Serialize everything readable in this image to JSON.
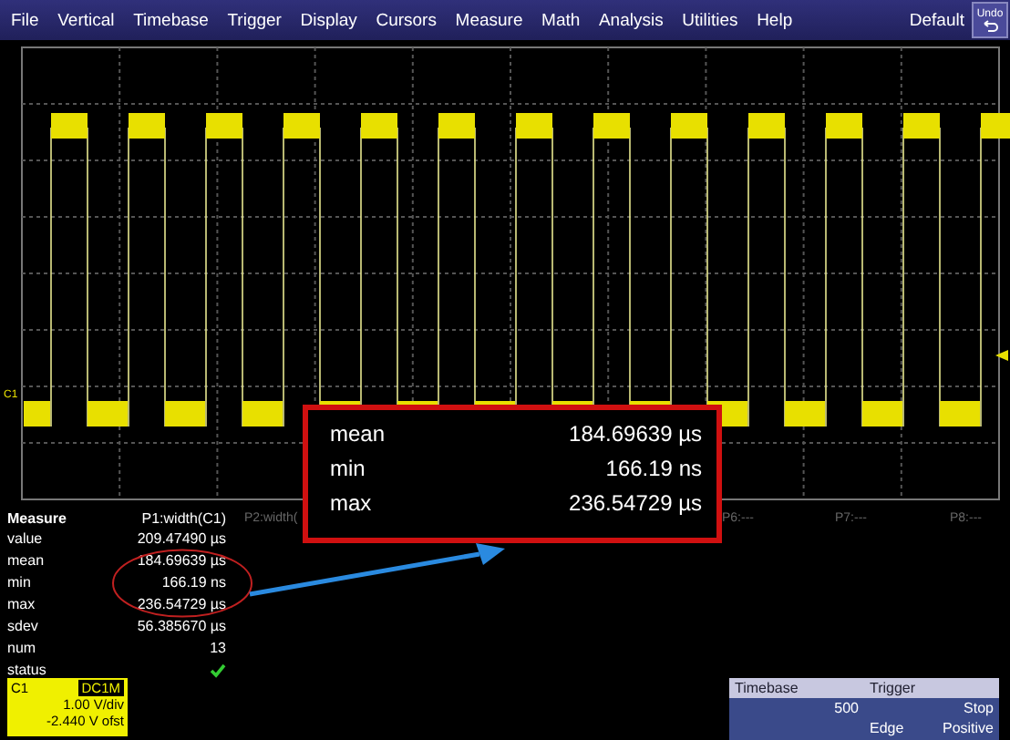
{
  "menu": {
    "items": [
      "File",
      "Vertical",
      "Timebase",
      "Trigger",
      "Display",
      "Cursors",
      "Measure",
      "Math",
      "Analysis",
      "Utilities",
      "Help"
    ],
    "preset": "Default",
    "undo": "Undo"
  },
  "scope": {
    "channel_marker": "C1"
  },
  "callout": {
    "rows": [
      {
        "label": "mean",
        "value": "184.69639 µs"
      },
      {
        "label": "min",
        "value": "166.19 ns"
      },
      {
        "label": "max",
        "value": "236.54729 µs"
      }
    ]
  },
  "measure": {
    "title": "Measure",
    "params": [
      {
        "label": "P1:width(C1)",
        "active": true
      },
      {
        "label": "P2:width(",
        "active": false
      },
      {
        "label": "P6:---",
        "active": false
      },
      {
        "label": "P7:---",
        "active": false
      },
      {
        "label": "P8:---",
        "active": false
      }
    ],
    "rows": [
      {
        "label": "value",
        "kind": "text",
        "value": "209.47490 µs"
      },
      {
        "label": "mean",
        "kind": "text",
        "value": "184.69639 µs"
      },
      {
        "label": "min",
        "kind": "text",
        "value": "166.19 ns"
      },
      {
        "label": "max",
        "kind": "text",
        "value": "236.54729 µs"
      },
      {
        "label": "sdev",
        "kind": "text",
        "value": "56.385670 µs"
      },
      {
        "label": "num",
        "kind": "text",
        "value": "13"
      },
      {
        "label": "status",
        "kind": "check"
      }
    ]
  },
  "channel": {
    "name": "C1",
    "coupling": "DC1M",
    "scale": "1.00 V/div",
    "offset": "-2.440 V ofst"
  },
  "timebase": {
    "title": "Timebase",
    "value": "500"
  },
  "trigger": {
    "title": "Trigger",
    "mode": "Stop",
    "type": "Edge",
    "slope": "Positive"
  }
}
